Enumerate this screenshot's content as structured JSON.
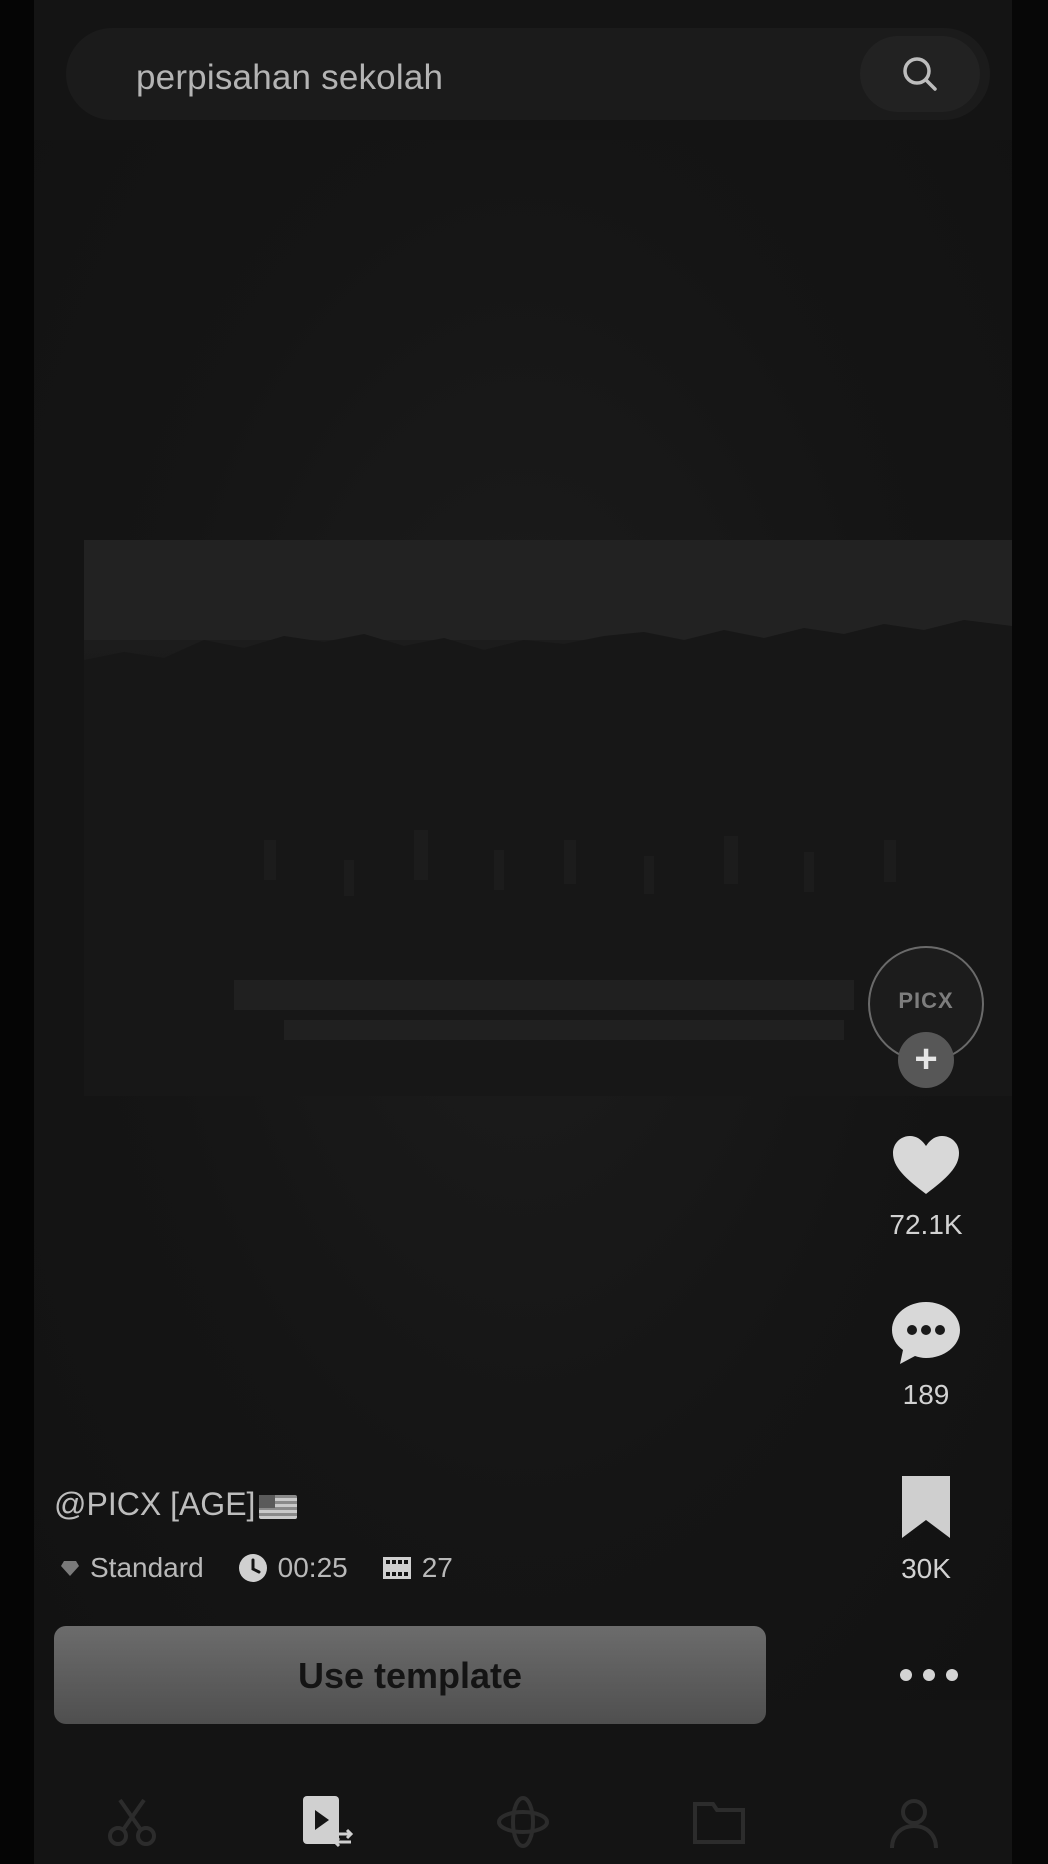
{
  "search": {
    "query": "perpisahan sekolah",
    "icon": "search-icon"
  },
  "creator": {
    "handle": "@PICX [AGE]",
    "avatar_text": "PICX",
    "flag_icon": "us-flag-icon"
  },
  "meta": {
    "quality": "Standard",
    "duration": "00:25",
    "clips": "27"
  },
  "actions": {
    "likes": "72.1K",
    "comments": "189",
    "saves": "30K",
    "follow_label": "+"
  },
  "cta": {
    "use_template_label": "Use template"
  },
  "bottom_nav": {
    "items": [
      {
        "icon": "scissors-icon"
      },
      {
        "icon": "template-icon",
        "active": true
      },
      {
        "icon": "orbit-icon"
      },
      {
        "icon": "folder-icon"
      },
      {
        "icon": "profile-icon"
      }
    ]
  },
  "colors": {
    "background": "#141414",
    "text": "#d2d2d2",
    "button": "#5e5e5e"
  }
}
